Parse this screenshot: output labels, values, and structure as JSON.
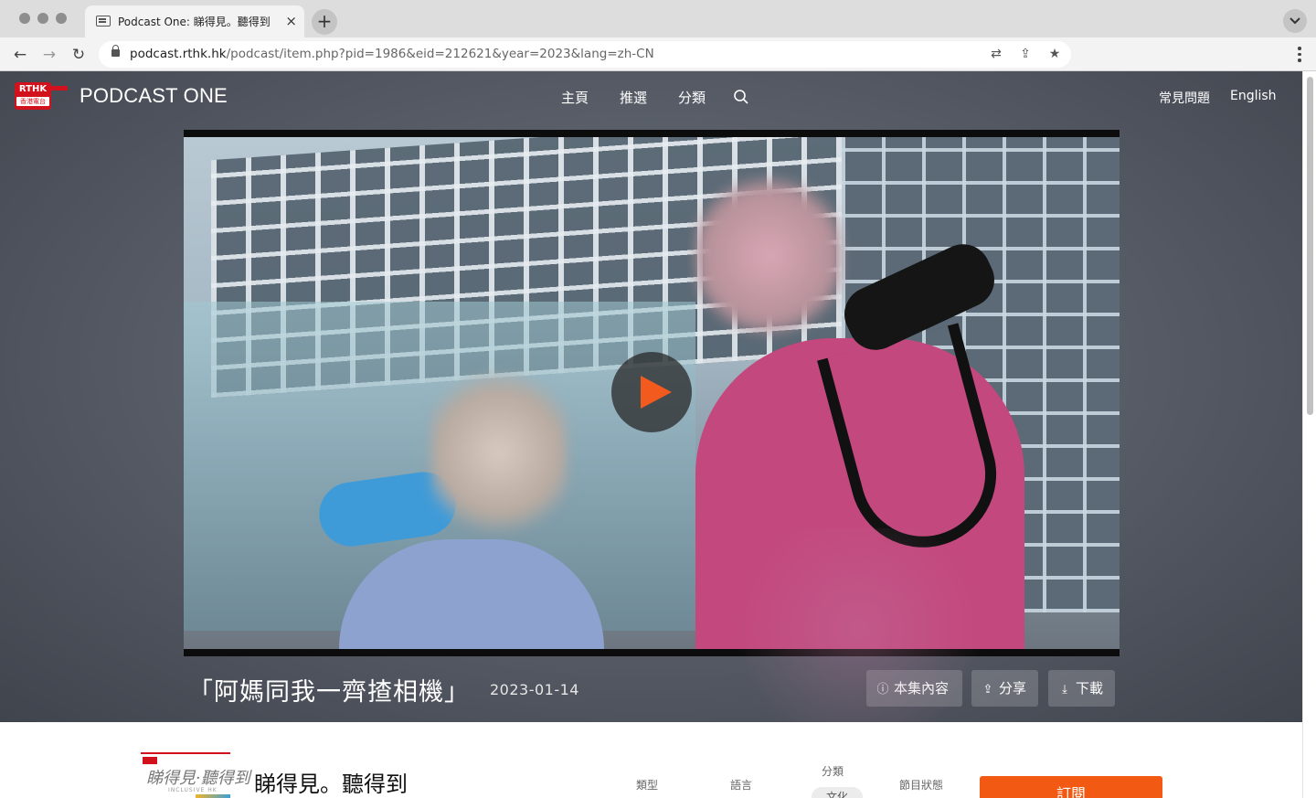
{
  "browser": {
    "tab_title": "Podcast One: 睇得見。聽得到 - 「阿媽同我一齊揸相機」",
    "tab_close": "×",
    "new_tab": "+",
    "url_host": "podcast.rthk.hk",
    "url_path": "/podcast/item.php?pid=1986&eid=212621&year=2023&lang=zh-CN"
  },
  "site": {
    "logo_top": "RTHK",
    "logo_bottom": "香港電台",
    "brand": "PODCAST ONE",
    "nav": [
      "主頁",
      "推選",
      "分類"
    ],
    "faq": "常見問題",
    "language": "English"
  },
  "episode": {
    "title": "「阿媽同我一齊揸相機」",
    "date": "2023-01-14",
    "actions": {
      "info": "本集內容",
      "share": "分享",
      "download": "下載"
    }
  },
  "show": {
    "cover_text": "睇得見·聽得到",
    "cover_subtext": "INCLUSIVE HK",
    "title": "睇得見。聽得到",
    "meta": {
      "type_label": "類型",
      "language_label": "語言",
      "category_label": "分類",
      "category_value": "文化",
      "status_label": "節目狀態"
    },
    "subscribe": "訂閱"
  },
  "colors": {
    "accent": "#f25a14",
    "rthk_red": "#d1111b"
  }
}
